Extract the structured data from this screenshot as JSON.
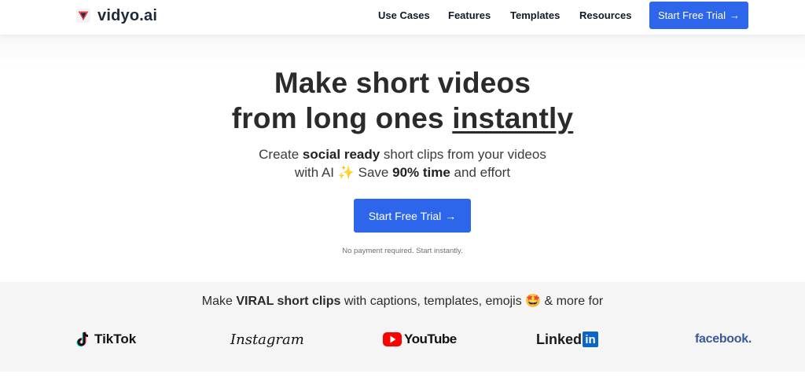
{
  "header": {
    "logo_text": "vidyo.ai",
    "nav": [
      "Use Cases",
      "Features",
      "Templates",
      "Resources"
    ],
    "cta_label": "Start Free Trial",
    "cta_arrow": "→"
  },
  "hero": {
    "headline_line1": "Make short videos",
    "headline_line2_prefix": "from long ones ",
    "headline_line2_emphasis": "instantly",
    "sub_line1_pre": "Create ",
    "sub_line1_bold": "social ready",
    "sub_line1_post": " short clips from your videos",
    "sub_line2_pre": "with AI ",
    "sparkle": "✨",
    "sub_line2_mid": " Save ",
    "sub_line2_bold": "90% time",
    "sub_line2_post": " and effort",
    "cta_label": "Start Free Trial",
    "cta_arrow": "→",
    "note": "No payment required. Start instantly."
  },
  "platforms": {
    "text_pre": "Make ",
    "text_bold": "VIRAL short clips",
    "text_post": " with captions, templates, emojis ",
    "emoji": "🤩",
    "text_end": " & more for",
    "brands": {
      "tiktok": "TikTok",
      "instagram": "Instagram",
      "youtube": "YouTube",
      "linkedin_a": "Linked",
      "linkedin_b": "in",
      "facebook": "facebook."
    }
  },
  "colors": {
    "accent": "#2d66eb",
    "band": "#f5f5f5",
    "facebook": "#3b5998",
    "linkedin": "#0a66c2",
    "youtube": "#ff0000"
  },
  "icons": [
    "vidyo-logo-icon",
    "arrow-right-icon",
    "tiktok-icon",
    "youtube-play-icon"
  ]
}
